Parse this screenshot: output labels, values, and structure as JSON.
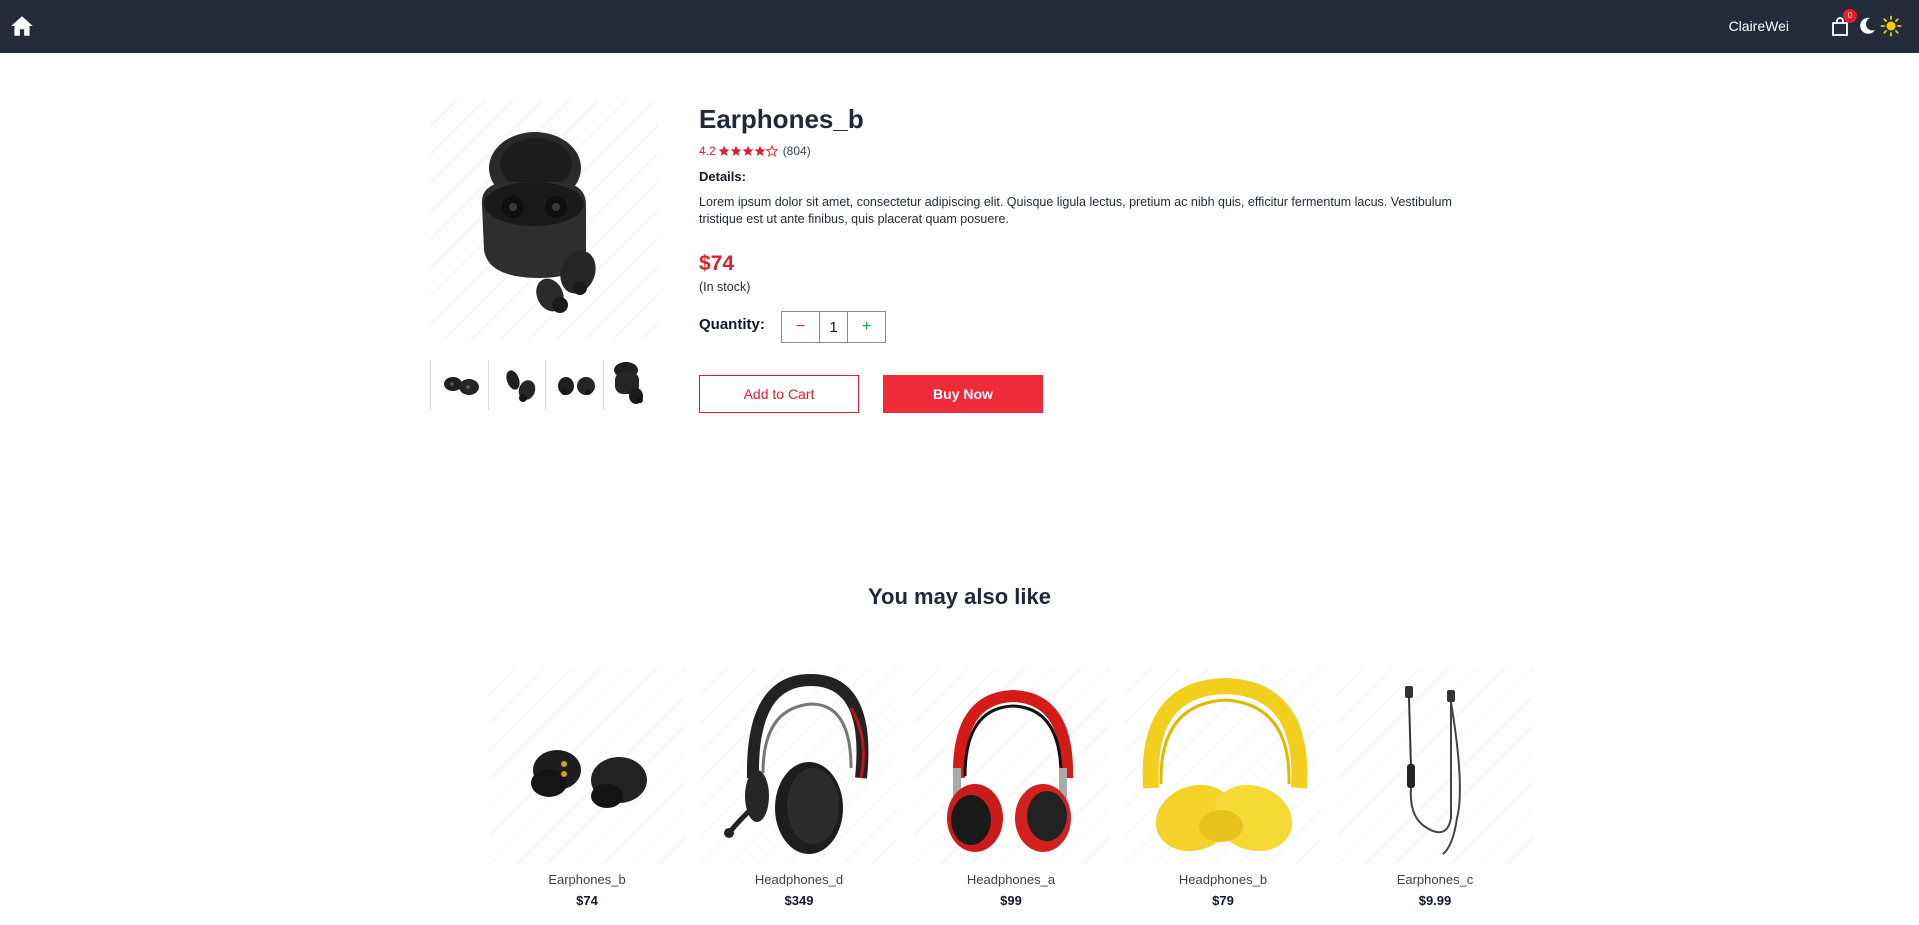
{
  "header": {
    "username": "ClaireWei",
    "cart_count": "0",
    "icons": [
      "home-icon",
      "shopping-bag-icon",
      "moon-icon",
      "sun-icon"
    ]
  },
  "product": {
    "title": "Earphones_b",
    "rating": "4.2",
    "rating_stars": 4.2,
    "reviews": "(804)",
    "details_label": "Details:",
    "description": "Lorem ipsum dolor sit amet, consectetur adipiscing elit. Quisque ligula lectus, pretium ac nibh quis, efficitur fermentum lacus. Vestibulum tristique est ut ante finibus, quis placerat quam posuere.",
    "price": "$74",
    "stock": "(In stock)",
    "quantity_label": "Quantity:",
    "quantity": "1",
    "minus_symbol": "−",
    "plus_symbol": "+",
    "add_to_cart": "Add to Cart",
    "buy_now": "Buy Now",
    "thumbnails": [
      "earphones-pair-thumb",
      "earphones-angled-thumb",
      "earphones-side-thumb",
      "earphones-case-thumb"
    ]
  },
  "suggestions": {
    "title": "You may also like",
    "items": [
      {
        "name": "Earphones_b",
        "price": "$74"
      },
      {
        "name": "Headphones_d",
        "price": "$349"
      },
      {
        "name": "Headphones_a",
        "price": "$99"
      },
      {
        "name": "Headphones_b",
        "price": "$79"
      },
      {
        "name": "Earphones_c",
        "price": "$9.99"
      }
    ]
  },
  "colors": {
    "nav_bg": "#242c3b",
    "accent_red": "#ef2b3b",
    "plus_green": "#16a34a"
  }
}
